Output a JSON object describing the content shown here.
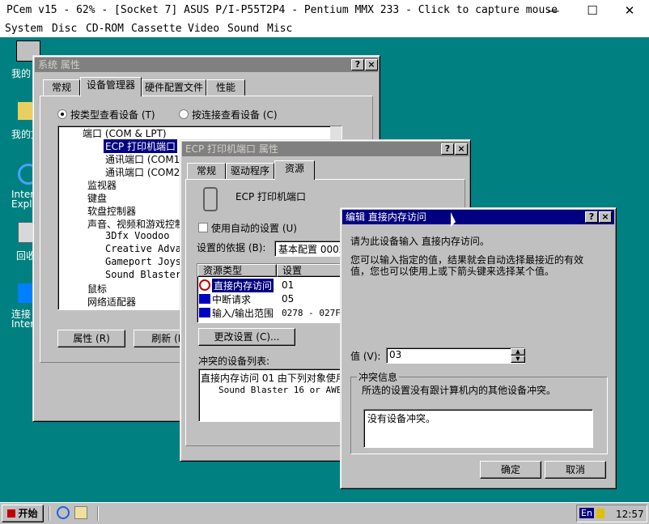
{
  "host": {
    "title": "PCem v15 - 62% - [Socket 7] ASUS P/I-P55T2P4 - Pentium MMX 233 - Click to capture mouse",
    "min": "—",
    "max": "☐",
    "close": "✕",
    "menu": [
      "System",
      "Disc",
      "CD-ROM",
      "Cassette",
      "Video",
      "Sound",
      "Misc"
    ]
  },
  "desktop": {
    "icons": [
      {
        "label": "我的"
      },
      {
        "label": "我的文"
      },
      {
        "label": "Inter\nExplo"
      },
      {
        "label": "回收"
      },
      {
        "label": "连接\nInter"
      }
    ]
  },
  "sys": {
    "title": "系统 属性",
    "help": "?",
    "close": "×",
    "tabs": [
      "常规",
      "设备管理器",
      "硬件配置文件",
      "性能"
    ],
    "radio1": "按类型查看设备 (T)",
    "radio2": "按连接查看设备 (C)",
    "tree": [
      "端口 (COM & LPT)",
      "ECP 打印机端口",
      "通讯端口 (COM1)",
      "通讯端口 (COM2)",
      "监视器",
      "键盘",
      "软盘控制器",
      "声音、视频和游戏控制",
      "3Dfx Voodoo",
      "Creative Advanc",
      "Gameport Joysti",
      "Sound Blaster 16",
      "鼠标",
      "网络适配器"
    ],
    "props_btn": "属性 (R)",
    "refresh_btn": "刷新 (F"
  },
  "ecp": {
    "title": "ECP 打印机端口 属性",
    "help": "?",
    "close": "×",
    "tabs": [
      "常规",
      "驱动程序",
      "资源"
    ],
    "device": "ECP 打印机端口",
    "auto": "使用自动的设置 (U)",
    "basis_label": "设置的依据 (B):",
    "basis_value": "基本配置 0002",
    "col_type": "资源类型",
    "col_set": "设置",
    "rows": [
      {
        "type": "直接内存访问",
        "set": "01"
      },
      {
        "type": "中断请求",
        "set": "05"
      },
      {
        "type": "输入/输出范围",
        "set": "0278 - 027F"
      }
    ],
    "change_btn": "更改设置 (C)...",
    "conflict_label": "冲突的设备列表:",
    "conflict_line1": "直接内存访问 01 由下列对象使用",
    "conflict_line2": "Sound Blaster 16 or AWE-3"
  },
  "edit": {
    "title": "编辑 直接内存访问",
    "help": "?",
    "close": "×",
    "line1": "请为此设备输入 直接内存访问。",
    "line2": "您可以输入指定的值，结果就会自动选择最接近的有效",
    "line3": "值，您也可以使用上或下箭头键来选择某个值。",
    "value_label": "值 (V):",
    "value": "03",
    "group": "冲突信息",
    "group_text": "所选的设置没有跟计算机内的其他设备冲突。",
    "box_text": "没有设备冲突。",
    "ok": "确定",
    "cancel": "取消"
  },
  "taskbar": {
    "start": "开始",
    "lang": "En",
    "time": "12:57"
  }
}
